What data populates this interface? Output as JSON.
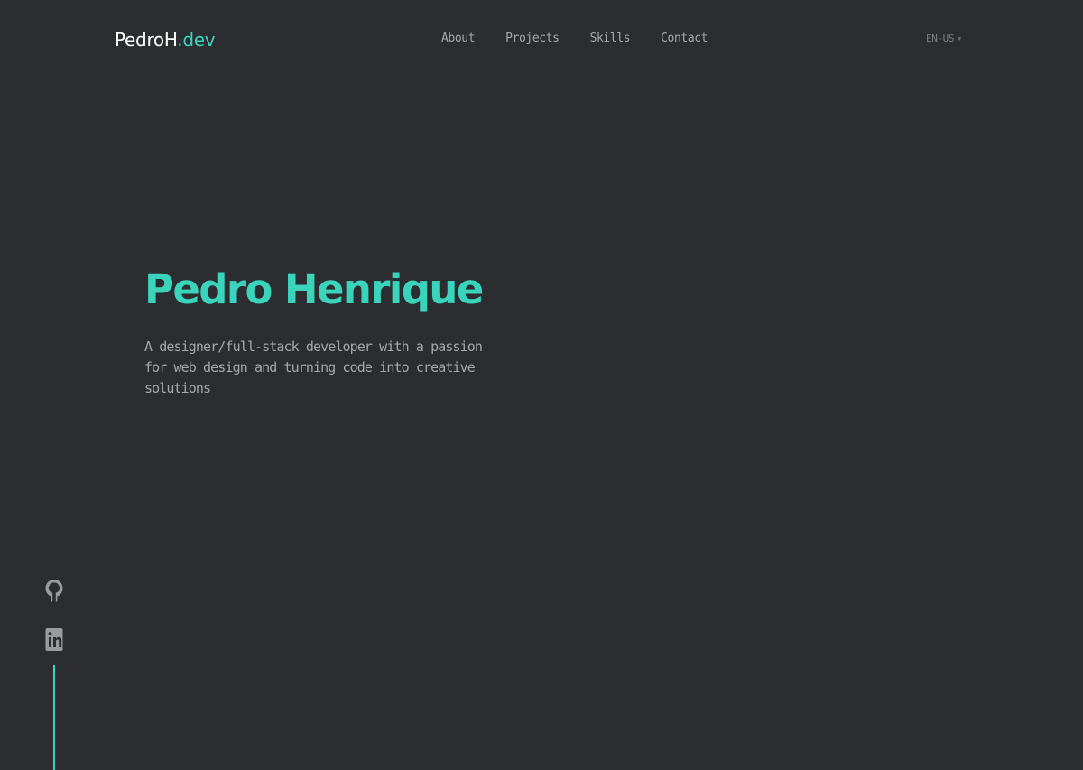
{
  "header": {
    "logo_main": "PedroH",
    "logo_accent": ".dev",
    "nav": [
      {
        "label": "About"
      },
      {
        "label": "Projects"
      },
      {
        "label": "Skills"
      },
      {
        "label": "Contact"
      }
    ],
    "language": {
      "selected": "EN-US",
      "icon": "chevron-down-icon"
    }
  },
  "hero": {
    "name": "Pedro Henrique",
    "tagline": "A designer/full-stack developer with a passion for web design and turning code into creative solutions"
  },
  "social": {
    "items": [
      {
        "icon": "github-icon"
      },
      {
        "icon": "linkedin-icon"
      }
    ]
  },
  "colors": {
    "background": "#2c2d31",
    "accent": "#3ad4bd",
    "text_muted": "#a6a7ab",
    "text_primary": "#ffffff"
  }
}
